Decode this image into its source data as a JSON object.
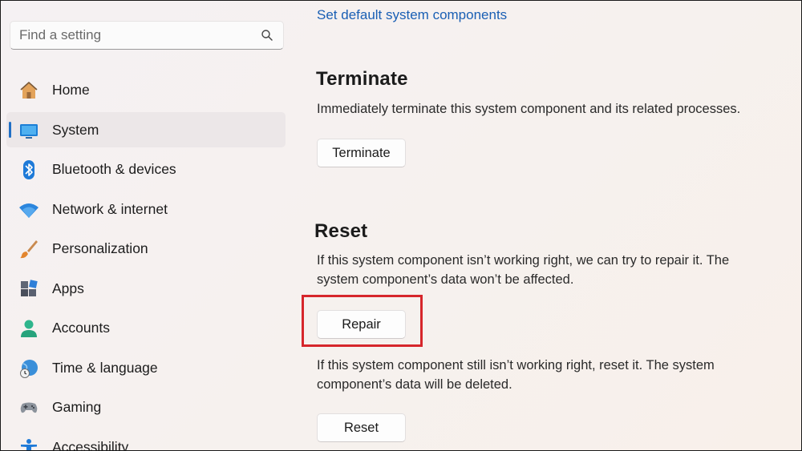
{
  "search": {
    "placeholder": "Find a setting"
  },
  "sidebar": {
    "items": [
      {
        "label": "Home",
        "icon": "home-icon",
        "selected": false
      },
      {
        "label": "System",
        "icon": "system-icon",
        "selected": true
      },
      {
        "label": "Bluetooth & devices",
        "icon": "bluetooth-icon",
        "selected": false
      },
      {
        "label": "Network & internet",
        "icon": "wifi-icon",
        "selected": false
      },
      {
        "label": "Personalization",
        "icon": "brush-icon",
        "selected": false
      },
      {
        "label": "Apps",
        "icon": "apps-icon",
        "selected": false
      },
      {
        "label": "Accounts",
        "icon": "accounts-icon",
        "selected": false
      },
      {
        "label": "Time & language",
        "icon": "time-language-icon",
        "selected": false
      },
      {
        "label": "Gaming",
        "icon": "gamepad-icon",
        "selected": false
      },
      {
        "label": "Accessibility",
        "icon": "accessibility-icon",
        "selected": false
      }
    ]
  },
  "main": {
    "link_label": "Set default system components",
    "terminate": {
      "heading": "Terminate",
      "description": "Immediately terminate this system component and its related processes.",
      "button_label": "Terminate"
    },
    "reset": {
      "heading": "Reset",
      "repair_description_line1": "If this system component isn’t working right, we can try to repair it. The",
      "repair_description_line2": "system component’s data won’t be affected.",
      "repair_button_label": "Repair",
      "reset_description_line1": "If this system component still isn’t working right, reset it. The system",
      "reset_description_line2": "component’s data will be deleted.",
      "reset_button_label": "Reset"
    }
  },
  "colors": {
    "accent": "#1f6fc5",
    "link": "#1a5fb4",
    "highlight_border": "#d6262b"
  }
}
